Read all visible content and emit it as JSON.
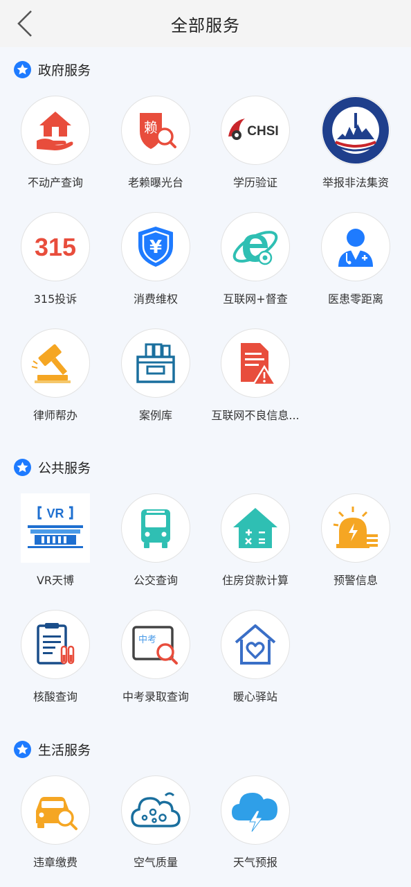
{
  "header": {
    "title": "全部服务",
    "back_icon": "chevron-left-icon"
  },
  "accent": "#1e7bff",
  "sections": [
    {
      "title": "政府服务",
      "items": [
        {
          "label": "不动产查询",
          "icon": "house-hand-icon"
        },
        {
          "label": "老赖曝光台",
          "icon": "shield-search-icon",
          "glyph": "赖"
        },
        {
          "label": "学历验证",
          "icon": "chsi-logo-icon",
          "glyph": "CHSI"
        },
        {
          "label": "举报非法集资",
          "icon": "tianjin-seal-icon"
        },
        {
          "label": "315投诉",
          "icon": "315-icon",
          "glyph": "315"
        },
        {
          "label": "消费维权",
          "icon": "yen-shield-icon",
          "glyph": "¥"
        },
        {
          "label": "互联网+督查",
          "icon": "ie-globe-icon"
        },
        {
          "label": "医患零距离",
          "icon": "doctor-icon"
        },
        {
          "label": "律师帮办",
          "icon": "gavel-icon"
        },
        {
          "label": "案例库",
          "icon": "archive-box-icon"
        },
        {
          "label": "互联网不良信息...",
          "icon": "document-warning-icon"
        }
      ]
    },
    {
      "title": "公共服务",
      "items": [
        {
          "label": "VR天博",
          "icon": "vr-building-icon",
          "glyph": "VR"
        },
        {
          "label": "公交查询",
          "icon": "bus-icon"
        },
        {
          "label": "住房贷款计算",
          "icon": "house-calculator-icon"
        },
        {
          "label": "预警信息",
          "icon": "alarm-light-icon"
        },
        {
          "label": "核酸查询",
          "icon": "clipboard-test-tube-icon"
        },
        {
          "label": "中考录取查询",
          "icon": "exam-search-icon",
          "glyph": "中考"
        },
        {
          "label": "暖心驿站",
          "icon": "house-heart-icon"
        }
      ]
    },
    {
      "title": "生活服务",
      "items": [
        {
          "label": "违章缴费",
          "icon": "car-search-icon"
        },
        {
          "label": "空气质量",
          "icon": "cloud-dots-icon"
        },
        {
          "label": "天气预报",
          "icon": "cloud-lightning-icon"
        }
      ]
    }
  ]
}
